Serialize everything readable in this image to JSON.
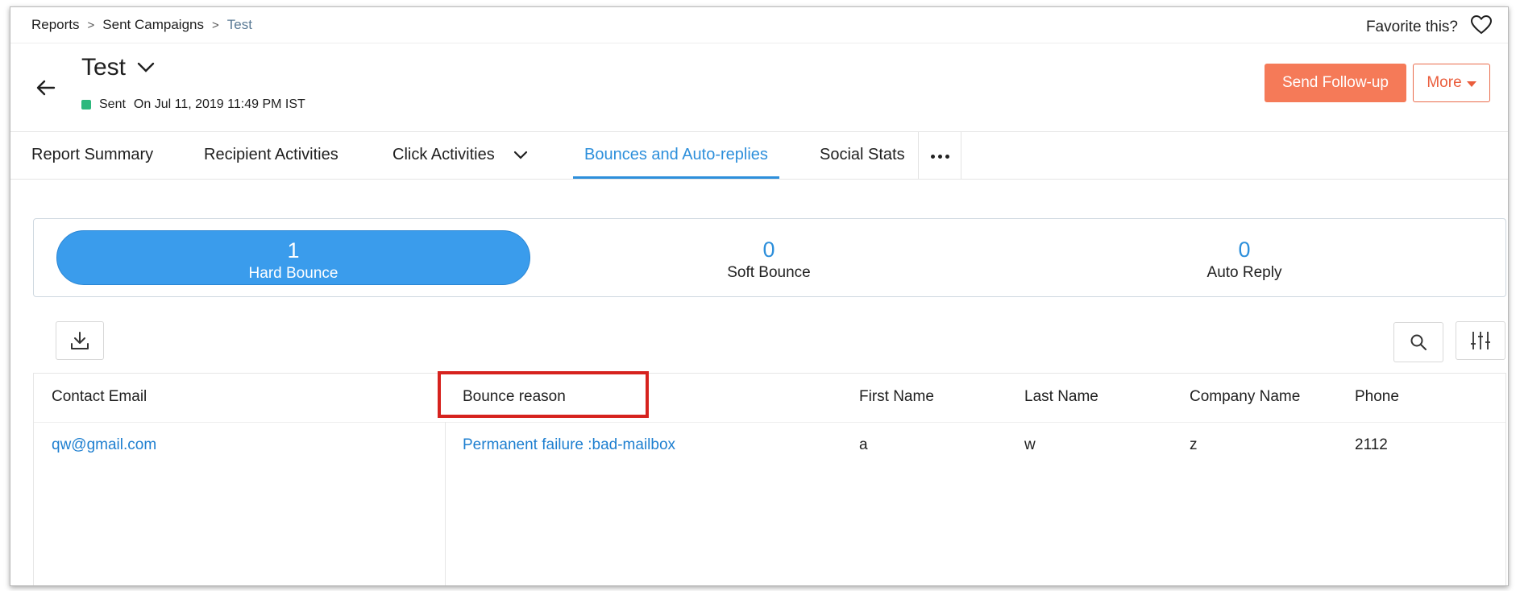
{
  "breadcrumb": {
    "items": [
      "Reports",
      "Sent Campaigns"
    ],
    "current": "Test",
    "separator": ">"
  },
  "favorite": {
    "label": "Favorite this?",
    "icon": "heart-icon"
  },
  "campaign": {
    "title": "Test",
    "status": "Sent",
    "sent_on": "On Jul 11, 2019 11:49 PM IST",
    "status_color": "#2db87d"
  },
  "actions": {
    "send_followup": "Send Follow-up",
    "more": "More",
    "accent_color": "#f57a58"
  },
  "tabs": [
    {
      "label": "Report Summary"
    },
    {
      "label": "Recipient Activities"
    },
    {
      "label": "Click Activities"
    },
    {
      "label": "Bounces and Auto-replies",
      "active": true
    },
    {
      "label": "Social Stats"
    }
  ],
  "summary": [
    {
      "value": "1",
      "label": "Hard Bounce",
      "selected": true
    },
    {
      "value": "0",
      "label": "Soft Bounce"
    },
    {
      "value": "0",
      "label": "Auto Reply"
    }
  ],
  "table": {
    "headers": [
      "Contact Email",
      "Bounce reason",
      "First Name",
      "Last Name",
      "Company Name",
      "Phone"
    ],
    "rows": [
      [
        "qw@gmail.com",
        "Permanent failure :bad-mailbox",
        "a",
        "w",
        "z",
        "2112"
      ]
    ]
  },
  "colors": {
    "link": "#1e7fd0",
    "active_tab": "#2d8fdb",
    "highlight": "#d6221e"
  }
}
